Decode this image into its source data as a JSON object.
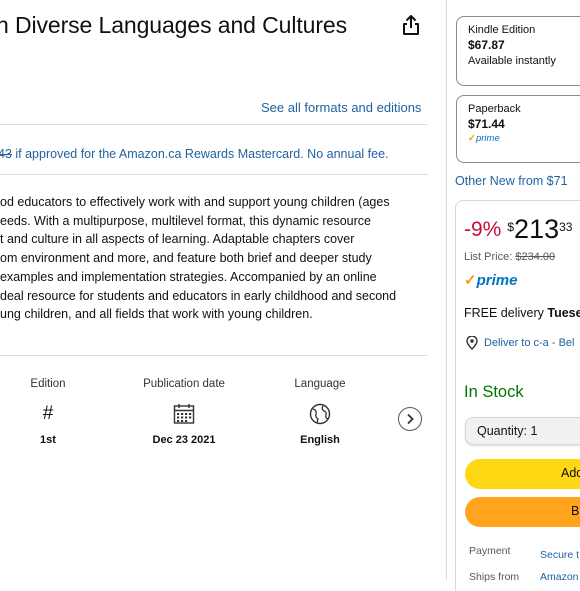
{
  "product": {
    "title": "n Diverse Languages and Cultures",
    "see_all_formats": "See all formats and editions"
  },
  "promo": {
    "struck": "43",
    "text": " if approved for the Amazon.ca Rewards Mastercard. No annual fee."
  },
  "description": {
    "lines": [
      "od educators to effectively work with and support young children (ages",
      "eeds. With a multipurpose, multilevel format, this dynamic resource",
      "t and culture in all aspects of learning. Adaptable chapters cover",
      "om environment and more, and feature both brief and deeper study",
      "examples and implementation strategies. Accompanied by an online",
      "deal resource for students and educators in early childhood and second",
      "ung children, and all fields that work with young children."
    ]
  },
  "attributes": {
    "edition": {
      "label": "Edition",
      "icon": "hash-icon",
      "glyph": "#",
      "value": "1st"
    },
    "publication_date": {
      "label": "Publication date",
      "icon": "calendar-icon",
      "value": "Dec 23 2021"
    },
    "language": {
      "label": "Language",
      "icon": "globe-icon",
      "value": "English"
    }
  },
  "formats": [
    {
      "name": "Kindle Edition",
      "price": "$67.87",
      "availability": "Available instantly"
    },
    {
      "name": "Paperback",
      "price": "$71.44",
      "prime": "prime"
    }
  ],
  "other_new": "Other New from $71",
  "buybox": {
    "discount": "-9%",
    "currency": "$",
    "price_whole": "213",
    "price_fraction": "33",
    "list_price_label": "List Price: ",
    "list_price": "$234.00",
    "prime": "prime",
    "free_delivery_label": "FREE delivery ",
    "free_delivery_day": "Tuese",
    "deliver_to": "Deliver to c-a - Bel",
    "in_stock": "In Stock",
    "quantity_label": "Quantity: 1",
    "add_to_cart": "Add",
    "buy_now": "B",
    "payment_label": "Payment",
    "payment_value": "Secure t",
    "ships_from_label": "Ships from",
    "ships_from_value": "Amazon"
  },
  "colors": {
    "link": "#2162a1",
    "discount": "#cc0c39",
    "in_stock": "#007600",
    "add_to_cart": "#ffd814",
    "buy_now": "#ffa41c",
    "prime": "#0073c4"
  }
}
